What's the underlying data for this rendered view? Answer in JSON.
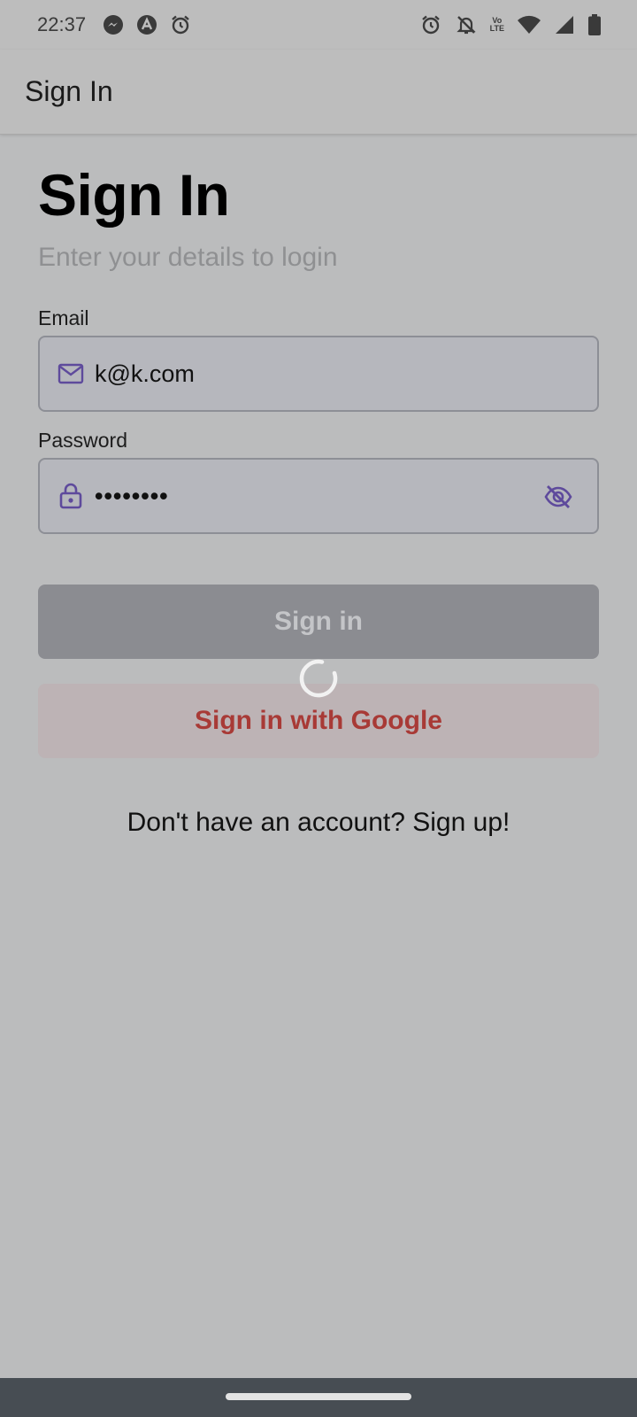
{
  "status_bar": {
    "time": "22:37",
    "left_icons": [
      "messenger-icon",
      "app-a-icon",
      "alarm-icon"
    ],
    "right_icons": [
      "alarm-icon",
      "bell-off-icon",
      "volte-icon",
      "wifi-icon",
      "signal-icon",
      "battery-icon"
    ],
    "volte_label_top": "Vo",
    "volte_label_bottom": "LTE"
  },
  "app_bar": {
    "title": "Sign In"
  },
  "main": {
    "title": "Sign In",
    "subtitle": "Enter your details to login",
    "email": {
      "label": "Email",
      "value": "k@k.com",
      "icon": "mail-icon"
    },
    "password": {
      "label": "Password",
      "value": "••••••••",
      "icon": "lock-icon",
      "toggle_icon": "eye-off-icon"
    },
    "signin_button_label": "Sign in",
    "google_button_label": "Sign in with Google",
    "signup_text": "Don't have an account? Sign up!",
    "loading": true
  },
  "colors": {
    "background": "#bbbcbd",
    "accent": "#5e4a9c",
    "google_text": "#a83a36",
    "nav_bar": "#474d53"
  }
}
